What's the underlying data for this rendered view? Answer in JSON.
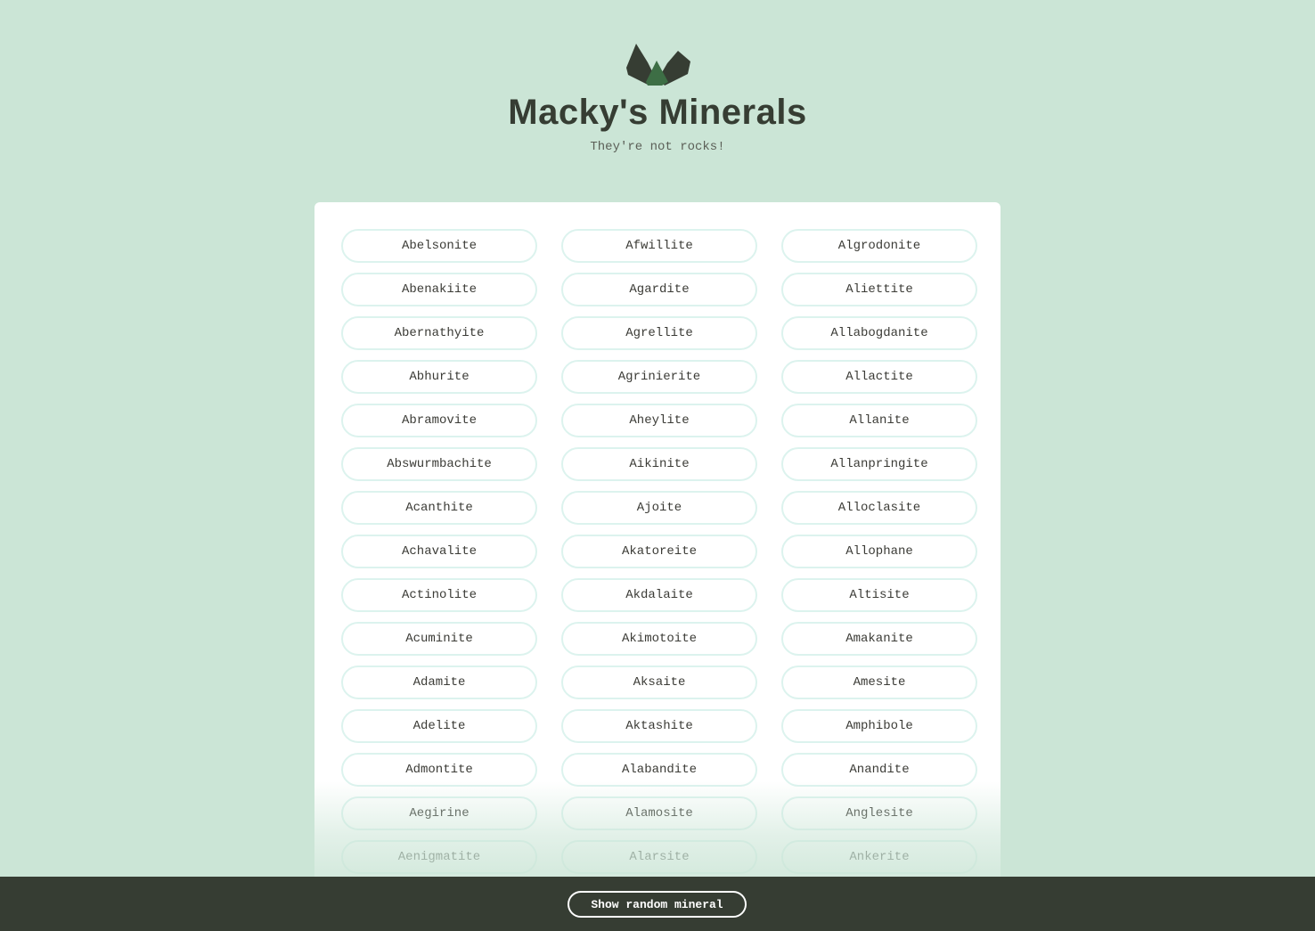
{
  "header": {
    "title": "Macky's Minerals",
    "tagline": "They're not rocks!"
  },
  "colors": {
    "background": "#cbe5d6",
    "dark": "#363d33",
    "accent": "#3d6e45",
    "pill_border": "#dcf3ee"
  },
  "minerals": [
    "Abelsonite",
    "Afwillite",
    "Algrodonite",
    "Abenakiite",
    "Agardite",
    "Aliettite",
    "Abernathyite",
    "Agrellite",
    "Allabogdanite",
    "Abhurite",
    "Agrinierite",
    "Allactite",
    "Abramovite",
    "Aheylite",
    "Allanite",
    "Abswurmbachite",
    "Aikinite",
    "Allanpringite",
    "Acanthite",
    "Ajoite",
    "Alloclasite",
    "Achavalite",
    "Akatoreite",
    "Allophane",
    "Actinolite",
    "Akdalaite",
    "Altisite",
    "Acuminite",
    "Akimotoite",
    "Amakanite",
    "Adamite",
    "Aksaite",
    "Amesite",
    "Adelite",
    "Aktashite",
    "Amphibole",
    "Admontite",
    "Alabandite",
    "Anandite",
    "Aegirine",
    "Alamosite",
    "Anglesite",
    "Aenigmatite",
    "Alarsite",
    "Ankerite"
  ],
  "footer": {
    "random_button_label": "Show random mineral"
  }
}
